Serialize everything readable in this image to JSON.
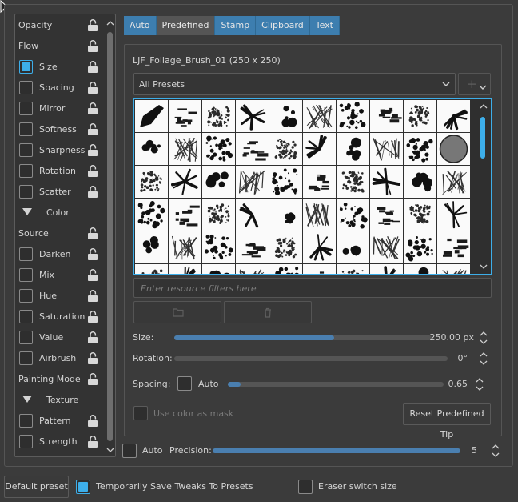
{
  "options": [
    {
      "label": "Opacity",
      "checkbox": false,
      "checked": false
    },
    {
      "label": "Flow",
      "checkbox": false,
      "checked": false
    },
    {
      "label": "Size",
      "checkbox": true,
      "checked": true
    },
    {
      "label": "Spacing",
      "checkbox": true,
      "checked": false
    },
    {
      "label": "Mirror",
      "checkbox": true,
      "checked": false
    },
    {
      "label": "Softness",
      "checkbox": true,
      "checked": false
    },
    {
      "label": "Sharpness",
      "checkbox": true,
      "checked": false
    },
    {
      "label": "Rotation",
      "checkbox": true,
      "checked": false
    },
    {
      "label": "Scatter",
      "checkbox": true,
      "checked": false
    },
    {
      "label": "Color",
      "section": true
    },
    {
      "label": "Source",
      "checkbox": false,
      "checked": false
    },
    {
      "label": "Darken",
      "checkbox": true,
      "checked": false
    },
    {
      "label": "Mix",
      "checkbox": true,
      "checked": false
    },
    {
      "label": "Hue",
      "checkbox": true,
      "checked": false
    },
    {
      "label": "Saturation",
      "checkbox": true,
      "checked": false
    },
    {
      "label": "Value",
      "checkbox": true,
      "checked": false
    },
    {
      "label": "Airbrush",
      "checkbox": true,
      "checked": false
    },
    {
      "label": "Painting Mode",
      "checkbox": false,
      "checked": false
    },
    {
      "label": "Texture",
      "section": true
    },
    {
      "label": "Pattern",
      "checkbox": true,
      "checked": false
    },
    {
      "label": "Strength",
      "checkbox": true,
      "checked": false
    }
  ],
  "tabs": [
    {
      "label": "Auto",
      "active": false
    },
    {
      "label": "Predefined",
      "active": true
    },
    {
      "label": "Stamp",
      "active": false
    },
    {
      "label": "Clipboard",
      "active": false
    },
    {
      "label": "Text",
      "active": false
    }
  ],
  "brush_title": "LJF_Foliage_Brush_01 (250 x 250)",
  "preset_combo": {
    "value": "All Presets"
  },
  "add_button": {
    "label": "+"
  },
  "filter": {
    "placeholder": "Enter resource filters here"
  },
  "size": {
    "label": "Size:",
    "value": "250.00 px",
    "fraction": 0.62
  },
  "rotation": {
    "label": "Rotation:",
    "value": "0°",
    "fraction": 0.0
  },
  "spacing": {
    "label": "Spacing:",
    "auto_label": "Auto",
    "auto_checked": false,
    "value": "0.65",
    "fraction": 0.06
  },
  "color_mask": {
    "label": "Use color as mask",
    "enabled": false
  },
  "reset_button": {
    "label": "Reset Predefined Tip"
  },
  "precision": {
    "auto_label": "Auto",
    "label": "Precision:",
    "value": "5",
    "fraction": 1.0
  },
  "footer": {
    "default_preset": "Default preset",
    "temp_save": "Temporarily Save Tweaks To Presets",
    "temp_save_checked": true,
    "eraser_switch": "Eraser switch size",
    "eraser_checked": false
  },
  "colors": {
    "accent": "#3daee9",
    "tab_bg": "#3d7eaf",
    "slider_fill": "#4a7fb0",
    "panel_bg": "#3b3b3b"
  }
}
